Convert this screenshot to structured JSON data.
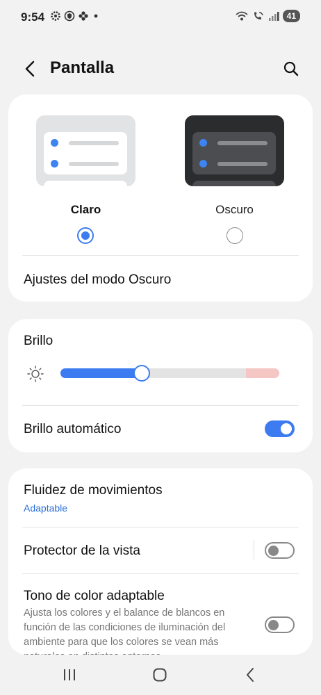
{
  "status_bar": {
    "time": "9:54",
    "left_icons": [
      "gear-icon",
      "shield-icon",
      "flower-icon",
      "dot-icon"
    ],
    "right_icons": [
      "wifi-icon",
      "wifi-calling-icon",
      "signal-icon"
    ],
    "battery": "41"
  },
  "app_bar": {
    "title": "Pantalla",
    "back_icon": "chevron-left-icon",
    "search_icon": "search-icon"
  },
  "display_mode": {
    "light_label": "Claro",
    "dark_label": "Oscuro",
    "selected": "light",
    "dark_settings_label": "Ajustes del modo Oscuro"
  },
  "brightness": {
    "title": "Brillo",
    "level_percent": 37,
    "auto_label": "Brillo automático",
    "auto_enabled": true
  },
  "other_settings": {
    "motion_label": "Fluidez de movimientos",
    "motion_value": "Adaptable",
    "eye_comfort_label": "Protector de la vista",
    "eye_comfort_enabled": false,
    "adaptive_tone_label": "Tono de color adaptable",
    "adaptive_tone_desc": "Ajusta los colores y el balance de blancos en función de las condiciones de iluminación del ambiente para que los colores se vean más naturales en distintos entornos.",
    "adaptive_tone_enabled": false
  },
  "nav_bar": {
    "recents_icon": "recents-icon",
    "home_icon": "home-icon",
    "back_icon": "back-icon"
  },
  "colors": {
    "accent": "#3d7cf0",
    "background": "#f2f2f2",
    "card": "#ffffff",
    "link": "#2a6fd8"
  }
}
